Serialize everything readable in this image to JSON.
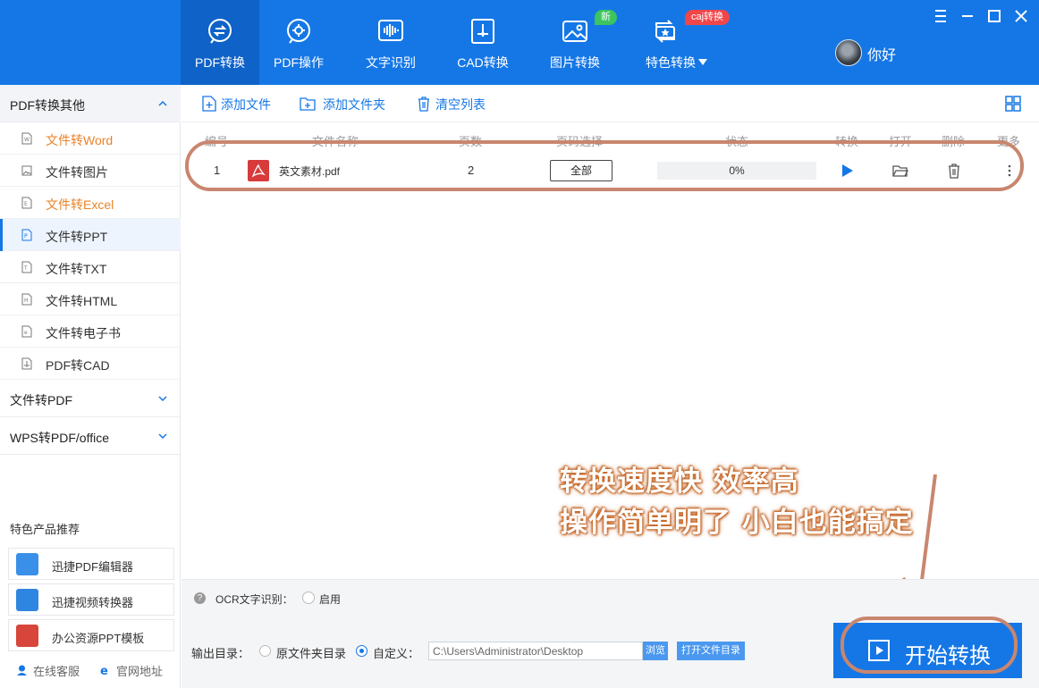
{
  "nav": {
    "items": [
      {
        "label": "PDF转换",
        "icon": "pdf-convert-icon"
      },
      {
        "label": "PDF操作",
        "icon": "pdf-operate-icon"
      },
      {
        "label": "文字识别",
        "icon": "ocr-icon"
      },
      {
        "label": "CAD转换",
        "icon": "cad-icon"
      },
      {
        "label": "图片转换",
        "icon": "image-icon"
      },
      {
        "label": "特色转换",
        "icon": "special-icon"
      }
    ],
    "badges": {
      "image": "新",
      "special": "caj转换"
    },
    "user_name": "你好",
    "colors": {
      "brand": "#1577e6",
      "active": "#0f62c7",
      "badge_new": "#3bc45f",
      "badge_caj": "#f0464a"
    }
  },
  "sidebar": {
    "groups": [
      {
        "label": "PDF转换其他",
        "expanded": true
      },
      {
        "label": "文件转PDF",
        "expanded": false
      },
      {
        "label": "WPS转PDF/office",
        "expanded": false
      }
    ],
    "items": [
      {
        "label": "文件转Word",
        "highlight": true
      },
      {
        "label": "文件转图片",
        "highlight": false
      },
      {
        "label": "文件转Excel",
        "highlight": true
      },
      {
        "label": "文件转PPT",
        "highlight": false,
        "active": true
      },
      {
        "label": "文件转TXT",
        "highlight": false
      },
      {
        "label": "文件转HTML",
        "highlight": false
      },
      {
        "label": "文件转电子书",
        "highlight": false
      },
      {
        "label": "PDF转CAD",
        "highlight": false
      }
    ],
    "recommend_title": "特色产品推荐",
    "recommend": [
      {
        "label": "迅捷PDF编辑器"
      },
      {
        "label": "迅捷视频转换器"
      },
      {
        "label": "办公资源PPT模板"
      }
    ],
    "footer": {
      "service": "在线客服",
      "website": "官网地址"
    }
  },
  "toolbar": {
    "add_file": "添加文件",
    "add_folder": "添加文件夹",
    "clear_list": "清空列表"
  },
  "table": {
    "headers": [
      "编号",
      "文件名称",
      "页数",
      "页码选择",
      "状态",
      "转换",
      "打开",
      "删除",
      "更多"
    ],
    "rows": [
      {
        "index": "1",
        "name": "英文素材.pdf",
        "pages": "2",
        "page_select": "全部",
        "progress": 0,
        "status": "0%"
      }
    ]
  },
  "ocr": {
    "label": "OCR文字识别：",
    "enable_label": "启用",
    "enabled": false
  },
  "output": {
    "label": "输出目录：",
    "option_original": "原文件夹目录",
    "option_custom": "自定义：",
    "selected": "custom",
    "path": "C:\\Users\\Administrator\\Desktop",
    "browse": "浏览",
    "open_folder": "打开文件目录"
  },
  "start_button": "开始转换",
  "promo": {
    "line1": "转换速度快 效率高",
    "line2": "操作简单明了 小白也能搞定"
  }
}
